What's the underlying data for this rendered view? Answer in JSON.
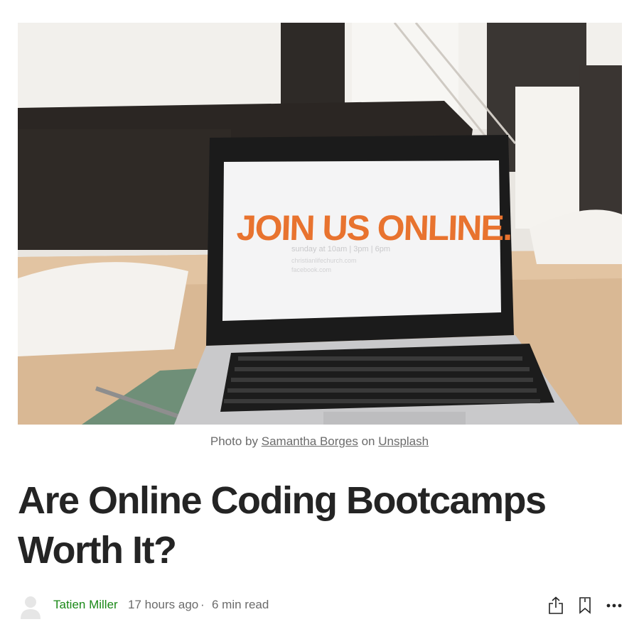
{
  "hero": {
    "image_name": "laptop-join-us-online-photo",
    "screen_headline": "JOIN US ONLINE.",
    "screen_subline": "sunday at 10am | 3pm | 6pm",
    "screen_line2": "christianlifechurch.com",
    "screen_line3": "facebook.com"
  },
  "caption": {
    "prefix": "Photo by",
    "photographer": "Samantha Borges",
    "middle": "on",
    "source": "Unsplash"
  },
  "article": {
    "title": "Are Online Coding Bootcamps Worth It?"
  },
  "meta": {
    "author": "Tatien Miller",
    "published": "17 hours ago",
    "separator": "·",
    "read_time": "6 min read"
  },
  "actions": {
    "share_icon": "share-icon",
    "bookmark_icon": "bookmark-icon",
    "more_icon": "more-icon"
  },
  "colors": {
    "author": "#1a8917",
    "text": "#242424",
    "muted": "#6b6b6b",
    "screen_headline": "#e8732f"
  }
}
